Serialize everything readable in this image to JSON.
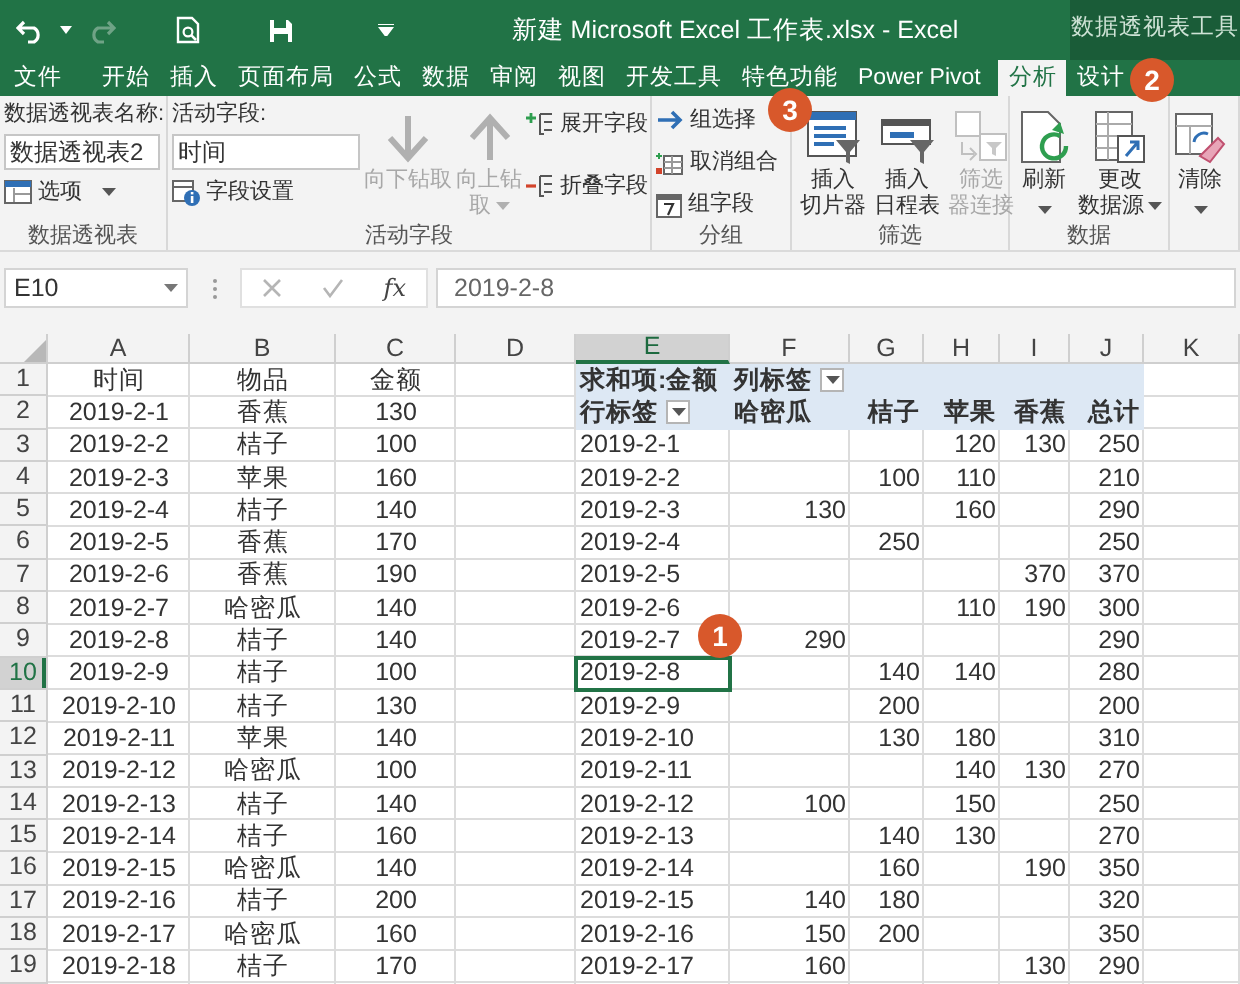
{
  "title_bar": {
    "title": "新建 Microsoft Excel 工作表.xlsx - Excel",
    "context_label": "数据透视表工具"
  },
  "ribbon_tabs": [
    {
      "label": "文件",
      "selected": false
    },
    {
      "label": "开始",
      "selected": false
    },
    {
      "label": "插入",
      "selected": false
    },
    {
      "label": "页面布局",
      "selected": false
    },
    {
      "label": "公式",
      "selected": false
    },
    {
      "label": "数据",
      "selected": false
    },
    {
      "label": "审阅",
      "selected": false
    },
    {
      "label": "视图",
      "selected": false
    },
    {
      "label": "开发工具",
      "selected": false
    },
    {
      "label": "特色功能",
      "selected": false
    },
    {
      "label": "Power Pivot",
      "selected": false
    },
    {
      "label": "分析",
      "selected": true
    },
    {
      "label": "设计",
      "selected": false
    }
  ],
  "ribbon": {
    "groups": [
      {
        "label": "数据透视表",
        "columns": [
          [
            {
              "kind": "caption",
              "label": "数据透视表名称:"
            },
            {
              "kind": "input",
              "value": "数据透视表2"
            },
            {
              "kind": "small",
              "label": "选项",
              "disabled": false,
              "dropdown": true
            }
          ]
        ]
      },
      {
        "label": "活动字段",
        "columns": [
          [
            {
              "kind": "caption",
              "label": "活动字段:"
            },
            {
              "kind": "input",
              "value": "时间"
            },
            {
              "kind": "small",
              "label": "字段设置",
              "disabled": false,
              "dropdown": false
            }
          ],
          [
            {
              "kind": "large",
              "lines": [
                "向下钻取"
              ],
              "disabled": true,
              "dropdown": false
            }
          ],
          [
            {
              "kind": "large",
              "lines": [
                "向上钻",
                "取"
              ],
              "disabled": true,
              "dropdown": true
            }
          ],
          [
            {
              "kind": "small",
              "label": "展开字段",
              "disabled": false,
              "dropdown": false
            },
            {
              "kind": "small",
              "label": "折叠字段",
              "disabled": false,
              "dropdown": false
            }
          ]
        ]
      },
      {
        "label": "分组",
        "columns": [
          [
            {
              "kind": "small",
              "label": "组选择",
              "disabled": false,
              "dropdown": false
            },
            {
              "kind": "small",
              "label": "取消组合",
              "disabled": false,
              "dropdown": false
            },
            {
              "kind": "small",
              "label": "组字段",
              "disabled": false,
              "dropdown": false
            }
          ]
        ]
      },
      {
        "label": "筛选",
        "columns": [
          [
            {
              "kind": "large",
              "lines": [
                "插入",
                "切片器"
              ],
              "disabled": false,
              "dropdown": false
            }
          ],
          [
            {
              "kind": "large",
              "lines": [
                "插入",
                "日程表"
              ],
              "disabled": false,
              "dropdown": false
            }
          ],
          [
            {
              "kind": "large",
              "lines": [
                "筛选",
                "器连接"
              ],
              "disabled": true,
              "dropdown": false
            }
          ]
        ]
      },
      {
        "label": "数据",
        "columns": [
          [
            {
              "kind": "large",
              "lines": [
                "刷新"
              ],
              "disabled": false,
              "dropdown": true
            }
          ],
          [
            {
              "kind": "large",
              "lines": [
                "更改",
                "数据源"
              ],
              "disabled": false,
              "dropdown": true
            }
          ]
        ]
      },
      {
        "columns": [
          [
            {
              "kind": "large",
              "lines": [
                "清除"
              ],
              "disabled": false,
              "dropdown": true
            }
          ]
        ]
      }
    ]
  },
  "formula_bar": {
    "name_box": "E10",
    "function_symbol": "fx",
    "formula": "2019-2-8"
  },
  "sheet": {
    "columns": [
      {
        "label": "A",
        "selected": false
      },
      {
        "label": "B",
        "selected": false
      },
      {
        "label": "C",
        "selected": false
      },
      {
        "label": "D",
        "selected": false
      },
      {
        "label": "E",
        "selected": true
      },
      {
        "label": "F",
        "selected": false
      },
      {
        "label": "G",
        "selected": false
      },
      {
        "label": "H",
        "selected": false
      },
      {
        "label": "I",
        "selected": false
      },
      {
        "label": "J",
        "selected": false
      },
      {
        "label": "K",
        "selected": false
      }
    ],
    "rows": [
      {
        "label": "1",
        "selected": false,
        "cells": [
          {
            "text": "时间",
            "kind": "text"
          },
          {
            "text": "物品",
            "kind": "text"
          },
          {
            "text": "金额",
            "kind": "text"
          },
          "",
          {
            "text": "求和项:金额",
            "kind": "caption"
          },
          {
            "text": "列标签",
            "kind": "caption",
            "filter": true
          },
          {
            "kind": "band"
          },
          {
            "kind": "band"
          },
          {
            "kind": "band"
          },
          {
            "kind": "band"
          },
          ""
        ]
      },
      {
        "label": "2",
        "selected": false,
        "cells": [
          {
            "text": "2019-2-1",
            "kind": "text"
          },
          {
            "text": "香蕉",
            "kind": "text"
          },
          {
            "text": "130",
            "kind": "text"
          },
          "",
          {
            "text": "行标签",
            "kind": "caption",
            "filter": true
          },
          {
            "text": "哈密瓜",
            "kind": "caption"
          },
          {
            "text": "桔子",
            "kind": "heading"
          },
          {
            "text": "苹果",
            "kind": "heading"
          },
          {
            "text": "香蕉",
            "kind": "heading"
          },
          {
            "text": "总计",
            "kind": "heading"
          },
          ""
        ]
      },
      {
        "label": "3",
        "selected": false,
        "cells": [
          {
            "text": "2019-2-2",
            "kind": "text"
          },
          {
            "text": "桔子",
            "kind": "text"
          },
          {
            "text": "100",
            "kind": "text"
          },
          "",
          {
            "text": "2019-2-1",
            "kind": "label"
          },
          "",
          "",
          {
            "text": "120",
            "kind": "number"
          },
          {
            "text": "130",
            "kind": "number"
          },
          {
            "text": "250",
            "kind": "number"
          },
          ""
        ]
      },
      {
        "label": "4",
        "selected": false,
        "cells": [
          {
            "text": "2019-2-3",
            "kind": "text"
          },
          {
            "text": "苹果",
            "kind": "text"
          },
          {
            "text": "160",
            "kind": "text"
          },
          "",
          {
            "text": "2019-2-2",
            "kind": "label"
          },
          "",
          {
            "text": "100",
            "kind": "number"
          },
          {
            "text": "110",
            "kind": "number"
          },
          "",
          {
            "text": "210",
            "kind": "number"
          },
          ""
        ]
      },
      {
        "label": "5",
        "selected": false,
        "cells": [
          {
            "text": "2019-2-4",
            "kind": "text"
          },
          {
            "text": "桔子",
            "kind": "text"
          },
          {
            "text": "140",
            "kind": "text"
          },
          "",
          {
            "text": "2019-2-3",
            "kind": "label"
          },
          {
            "text": "130",
            "kind": "number"
          },
          "",
          {
            "text": "160",
            "kind": "number"
          },
          "",
          {
            "text": "290",
            "kind": "number"
          },
          ""
        ]
      },
      {
        "label": "6",
        "selected": false,
        "cells": [
          {
            "text": "2019-2-5",
            "kind": "text"
          },
          {
            "text": "香蕉",
            "kind": "text"
          },
          {
            "text": "170",
            "kind": "text"
          },
          "",
          {
            "text": "2019-2-4",
            "kind": "label"
          },
          "",
          {
            "text": "250",
            "kind": "number"
          },
          "",
          "",
          {
            "text": "250",
            "kind": "number"
          },
          ""
        ]
      },
      {
        "label": "7",
        "selected": false,
        "cells": [
          {
            "text": "2019-2-6",
            "kind": "text"
          },
          {
            "text": "香蕉",
            "kind": "text"
          },
          {
            "text": "190",
            "kind": "text"
          },
          "",
          {
            "text": "2019-2-5",
            "kind": "label"
          },
          "",
          "",
          "",
          {
            "text": "370",
            "kind": "number"
          },
          {
            "text": "370",
            "kind": "number"
          },
          ""
        ]
      },
      {
        "label": "8",
        "selected": false,
        "cells": [
          {
            "text": "2019-2-7",
            "kind": "text"
          },
          {
            "text": "哈密瓜",
            "kind": "text"
          },
          {
            "text": "140",
            "kind": "text"
          },
          "",
          {
            "text": "2019-2-6",
            "kind": "label"
          },
          "",
          "",
          {
            "text": "110",
            "kind": "number"
          },
          {
            "text": "190",
            "kind": "number"
          },
          {
            "text": "300",
            "kind": "number"
          },
          ""
        ]
      },
      {
        "label": "9",
        "selected": false,
        "cells": [
          {
            "text": "2019-2-8",
            "kind": "text"
          },
          {
            "text": "桔子",
            "kind": "text"
          },
          {
            "text": "140",
            "kind": "text"
          },
          "",
          {
            "text": "2019-2-7",
            "kind": "label"
          },
          {
            "text": "290",
            "kind": "number"
          },
          "",
          "",
          "",
          {
            "text": "290",
            "kind": "number"
          },
          ""
        ]
      },
      {
        "label": "10",
        "selected": true,
        "cells": [
          {
            "text": "2019-2-9",
            "kind": "text"
          },
          {
            "text": "桔子",
            "kind": "text"
          },
          {
            "text": "100",
            "kind": "text"
          },
          "",
          {
            "text": "2019-2-8",
            "kind": "label"
          },
          "",
          {
            "text": "140",
            "kind": "number"
          },
          {
            "text": "140",
            "kind": "number"
          },
          "",
          {
            "text": "280",
            "kind": "number"
          },
          ""
        ]
      },
      {
        "label": "11",
        "selected": false,
        "cells": [
          {
            "text": "2019-2-10",
            "kind": "text"
          },
          {
            "text": "桔子",
            "kind": "text"
          },
          {
            "text": "130",
            "kind": "text"
          },
          "",
          {
            "text": "2019-2-9",
            "kind": "label"
          },
          "",
          {
            "text": "200",
            "kind": "number"
          },
          "",
          "",
          {
            "text": "200",
            "kind": "number"
          },
          ""
        ]
      },
      {
        "label": "12",
        "selected": false,
        "cells": [
          {
            "text": "2019-2-11",
            "kind": "text"
          },
          {
            "text": "苹果",
            "kind": "text"
          },
          {
            "text": "140",
            "kind": "text"
          },
          "",
          {
            "text": "2019-2-10",
            "kind": "label"
          },
          "",
          {
            "text": "130",
            "kind": "number"
          },
          {
            "text": "180",
            "kind": "number"
          },
          "",
          {
            "text": "310",
            "kind": "number"
          },
          ""
        ]
      },
      {
        "label": "13",
        "selected": false,
        "cells": [
          {
            "text": "2019-2-12",
            "kind": "text"
          },
          {
            "text": "哈密瓜",
            "kind": "text"
          },
          {
            "text": "100",
            "kind": "text"
          },
          "",
          {
            "text": "2019-2-11",
            "kind": "label"
          },
          "",
          "",
          {
            "text": "140",
            "kind": "number"
          },
          {
            "text": "130",
            "kind": "number"
          },
          {
            "text": "270",
            "kind": "number"
          },
          ""
        ]
      },
      {
        "label": "14",
        "selected": false,
        "cells": [
          {
            "text": "2019-2-13",
            "kind": "text"
          },
          {
            "text": "桔子",
            "kind": "text"
          },
          {
            "text": "140",
            "kind": "text"
          },
          "",
          {
            "text": "2019-2-12",
            "kind": "label"
          },
          {
            "text": "100",
            "kind": "number"
          },
          "",
          {
            "text": "150",
            "kind": "number"
          },
          "",
          {
            "text": "250",
            "kind": "number"
          },
          ""
        ]
      },
      {
        "label": "15",
        "selected": false,
        "cells": [
          {
            "text": "2019-2-14",
            "kind": "text"
          },
          {
            "text": "桔子",
            "kind": "text"
          },
          {
            "text": "160",
            "kind": "text"
          },
          "",
          {
            "text": "2019-2-13",
            "kind": "label"
          },
          "",
          {
            "text": "140",
            "kind": "number"
          },
          {
            "text": "130",
            "kind": "number"
          },
          "",
          {
            "text": "270",
            "kind": "number"
          },
          ""
        ]
      },
      {
        "label": "16",
        "selected": false,
        "cells": [
          {
            "text": "2019-2-15",
            "kind": "text"
          },
          {
            "text": "哈密瓜",
            "kind": "text"
          },
          {
            "text": "140",
            "kind": "text"
          },
          "",
          {
            "text": "2019-2-14",
            "kind": "label"
          },
          "",
          {
            "text": "160",
            "kind": "number"
          },
          "",
          {
            "text": "190",
            "kind": "number"
          },
          {
            "text": "350",
            "kind": "number"
          },
          ""
        ]
      },
      {
        "label": "17",
        "selected": false,
        "cells": [
          {
            "text": "2019-2-16",
            "kind": "text"
          },
          {
            "text": "桔子",
            "kind": "text"
          },
          {
            "text": "200",
            "kind": "text"
          },
          "",
          {
            "text": "2019-2-15",
            "kind": "label"
          },
          {
            "text": "140",
            "kind": "number"
          },
          {
            "text": "180",
            "kind": "number"
          },
          "",
          "",
          {
            "text": "320",
            "kind": "number"
          },
          ""
        ]
      },
      {
        "label": "18",
        "selected": false,
        "cells": [
          {
            "text": "2019-2-17",
            "kind": "text"
          },
          {
            "text": "哈密瓜",
            "kind": "text"
          },
          {
            "text": "160",
            "kind": "text"
          },
          "",
          {
            "text": "2019-2-16",
            "kind": "label"
          },
          {
            "text": "150",
            "kind": "number"
          },
          {
            "text": "200",
            "kind": "number"
          },
          "",
          "",
          {
            "text": "350",
            "kind": "number"
          },
          ""
        ]
      },
      {
        "label": "19",
        "selected": false,
        "cells": [
          {
            "text": "2019-2-18",
            "kind": "text"
          },
          {
            "text": "桔子",
            "kind": "text"
          },
          {
            "text": "170",
            "kind": "text"
          },
          "",
          {
            "text": "2019-2-17",
            "kind": "label"
          },
          {
            "text": "160",
            "kind": "number"
          },
          "",
          "",
          {
            "text": "130",
            "kind": "number"
          },
          {
            "text": "290",
            "kind": "number"
          },
          ""
        ]
      }
    ]
  },
  "callouts": [
    {
      "label": "1"
    },
    {
      "label": "2"
    },
    {
      "label": "3"
    }
  ]
}
